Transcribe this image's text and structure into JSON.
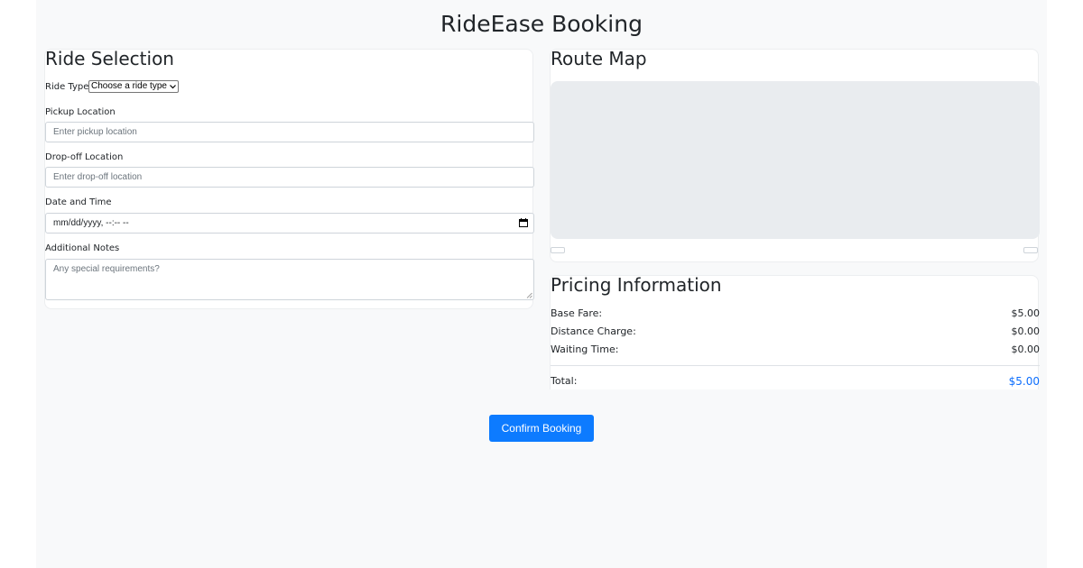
{
  "page": {
    "title": "RideEase Booking"
  },
  "ride_selection": {
    "title": "Ride Selection",
    "ride_type_label": "Ride Type",
    "ride_type_selected": "Choose a ride type",
    "pickup_label": "Pickup Location",
    "pickup_placeholder": "Enter pickup location",
    "dropoff_label": "Drop-off Location",
    "dropoff_placeholder": "Enter drop-off location",
    "datetime_label": "Date and Time",
    "datetime_value": "mm/dd/yyyy, --:-- --",
    "notes_label": "Additional Notes",
    "notes_placeholder": "Any special requirements?"
  },
  "route_map": {
    "title": "Route Map"
  },
  "pricing": {
    "title": "Pricing Information",
    "rows": [
      {
        "label": "Base Fare:",
        "value": "$5.00"
      },
      {
        "label": "Distance Charge:",
        "value": "$0.00"
      },
      {
        "label": "Waiting Time:",
        "value": "$0.00"
      }
    ],
    "total_label": "Total:",
    "total_value": "$5.00"
  },
  "actions": {
    "confirm_label": "Confirm Booking"
  },
  "colors": {
    "accent": "#0d7bff",
    "background": "#f8f9fa",
    "map_placeholder": "#e9ecef"
  },
  "icons": {
    "datetime": "calendar-icon",
    "select": "chevron-down-icon"
  }
}
